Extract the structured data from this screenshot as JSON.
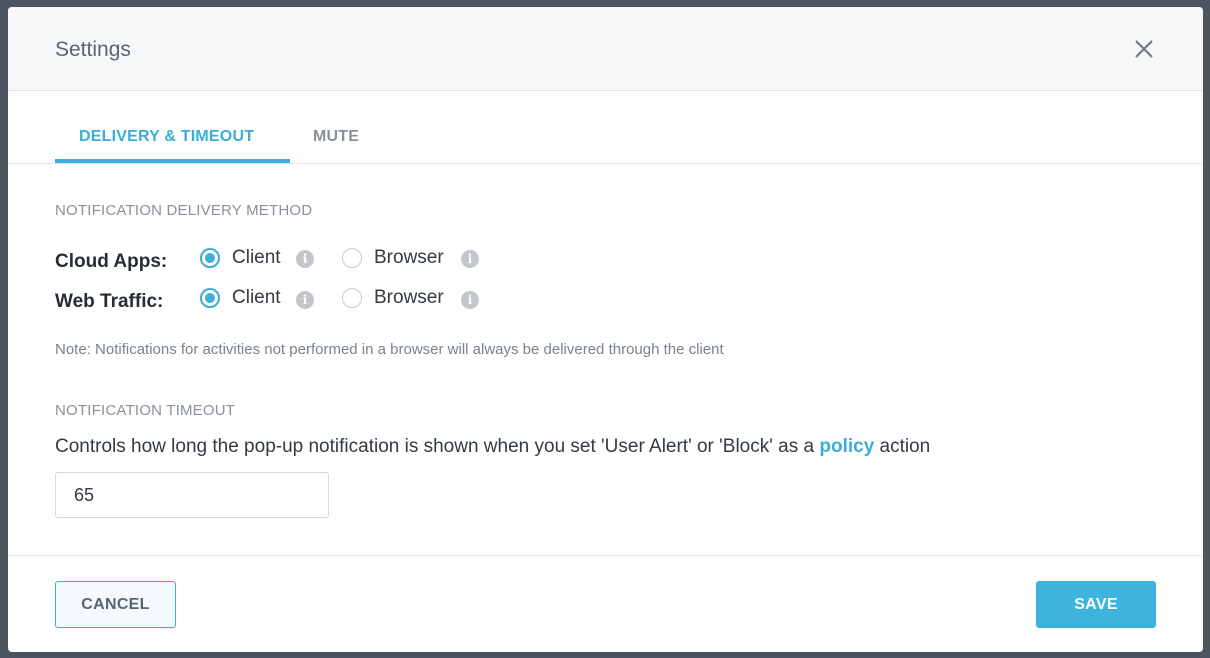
{
  "modal": {
    "title": "Settings"
  },
  "tabs": [
    {
      "label": "DELIVERY & TIMEOUT",
      "active": true
    },
    {
      "label": "MUTE",
      "active": false
    }
  ],
  "delivery": {
    "heading": "NOTIFICATION DELIVERY METHOD",
    "rows": [
      {
        "label": "Cloud Apps:",
        "options": [
          {
            "label": "Client",
            "checked": true
          },
          {
            "label": "Browser",
            "checked": false
          }
        ]
      },
      {
        "label": "Web Traffic:",
        "options": [
          {
            "label": "Client",
            "checked": true
          },
          {
            "label": "Browser",
            "checked": false
          }
        ]
      }
    ],
    "note": "Note: Notifications for activities not performed in a browser will always be delivered through the client"
  },
  "timeout": {
    "heading": "NOTIFICATION TIMEOUT",
    "description_before": "Controls how long the pop-up notification is shown when you set 'User Alert' or 'Block' as a ",
    "description_link": "policy",
    "description_after": " action",
    "value": "65"
  },
  "footer": {
    "cancel_label": "CANCEL",
    "save_label": "SAVE"
  },
  "icons": {
    "close": "close-icon",
    "info": "info-icon"
  },
  "colors": {
    "accent": "#3aaed8",
    "backdrop": "#4a5560"
  }
}
